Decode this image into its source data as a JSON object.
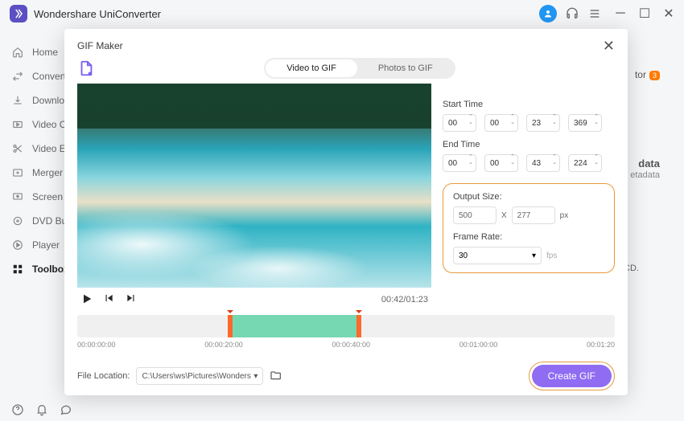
{
  "app": {
    "title": "Wondershare UniConverter"
  },
  "sidebar": {
    "items": [
      {
        "label": "Home"
      },
      {
        "label": "Convert..."
      },
      {
        "label": "Downloa..."
      },
      {
        "label": "Video C..."
      },
      {
        "label": "Video E..."
      },
      {
        "label": "Merger ..."
      },
      {
        "label": "Screen R..."
      },
      {
        "label": "DVD Bu..."
      },
      {
        "label": "Player"
      },
      {
        "label": "Toolbox"
      }
    ]
  },
  "behind": {
    "r1": "tor",
    "r1badge": "3",
    "r2": "data",
    "r2b": "etadata",
    "r3": "CD."
  },
  "modal": {
    "title": "GIF Maker",
    "tabs": {
      "video": "Video to GIF",
      "photos": "Photos to GIF"
    },
    "start_label": "Start Time",
    "end_label": "End Time",
    "start": {
      "h": "00",
      "m": "00",
      "s": "23",
      "ms": "369"
    },
    "end": {
      "h": "00",
      "m": "00",
      "s": "43",
      "ms": "224"
    },
    "output_label": "Output Size:",
    "output": {
      "w": "500",
      "sep": "X",
      "h": "277",
      "unit": "px"
    },
    "fr_label": "Frame Rate:",
    "fr_value": "30",
    "fr_unit": "fps",
    "time_display": "00:42/01:23",
    "ticks": [
      "00:00:00:00",
      "00:00:20:00",
      "00:00:40:00",
      "00:01:00:00",
      "00:01:20"
    ],
    "file_label": "File Location:",
    "file_path": "C:\\Users\\ws\\Pictures\\Wonders",
    "create": "Create GIF"
  }
}
